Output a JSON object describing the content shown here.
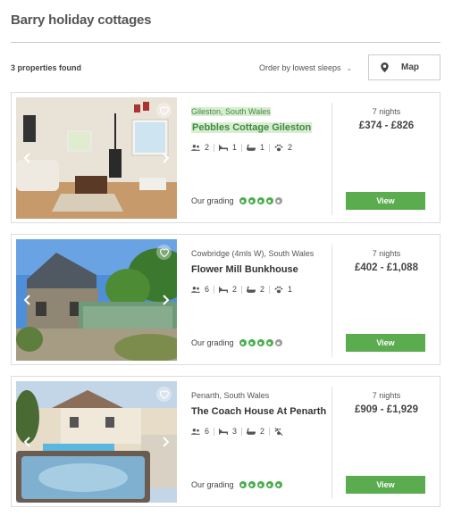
{
  "page": {
    "title": "Barry holiday cottages",
    "found_text": "3 properties found",
    "order_label": "Order by lowest sleeps",
    "map_label": "Map"
  },
  "colors": {
    "accent_green": "#5aac4f",
    "highlight_bg": "#d9edd3",
    "highlight_text": "#3f8a3f",
    "grading_on": "#4caf50",
    "grading_off": "#9e9e9e"
  },
  "properties": [
    {
      "location": "Gileston, South Wales",
      "name": "Pebbles Cottage Gileston",
      "highlighted": true,
      "sleeps": "2",
      "bedrooms": "1",
      "bathrooms": "1",
      "pets": "2",
      "grading_label": "Our grading",
      "grading": 4,
      "grading_max": 5,
      "nights": "7 nights",
      "price": "£374 - £826",
      "view_label": "View"
    },
    {
      "location": "Cowbridge (4mls W), South Wales",
      "name": "Flower Mill Bunkhouse",
      "highlighted": false,
      "sleeps": "6",
      "bedrooms": "2",
      "bathrooms": "2",
      "pets": "1",
      "grading_label": "Our grading",
      "grading": 4,
      "grading_max": 5,
      "nights": "7 nights",
      "price": "£402 - £1,088",
      "view_label": "View"
    },
    {
      "location": "Penarth, South Wales",
      "name": "The Coach House At Penarth",
      "highlighted": false,
      "sleeps": "6",
      "bedrooms": "3",
      "bathrooms": "2",
      "pets": "no-pets",
      "grading_label": "Our grading",
      "grading": 5,
      "grading_max": 5,
      "nights": "7 nights",
      "price": "£909 - £1,929",
      "view_label": "View"
    }
  ]
}
